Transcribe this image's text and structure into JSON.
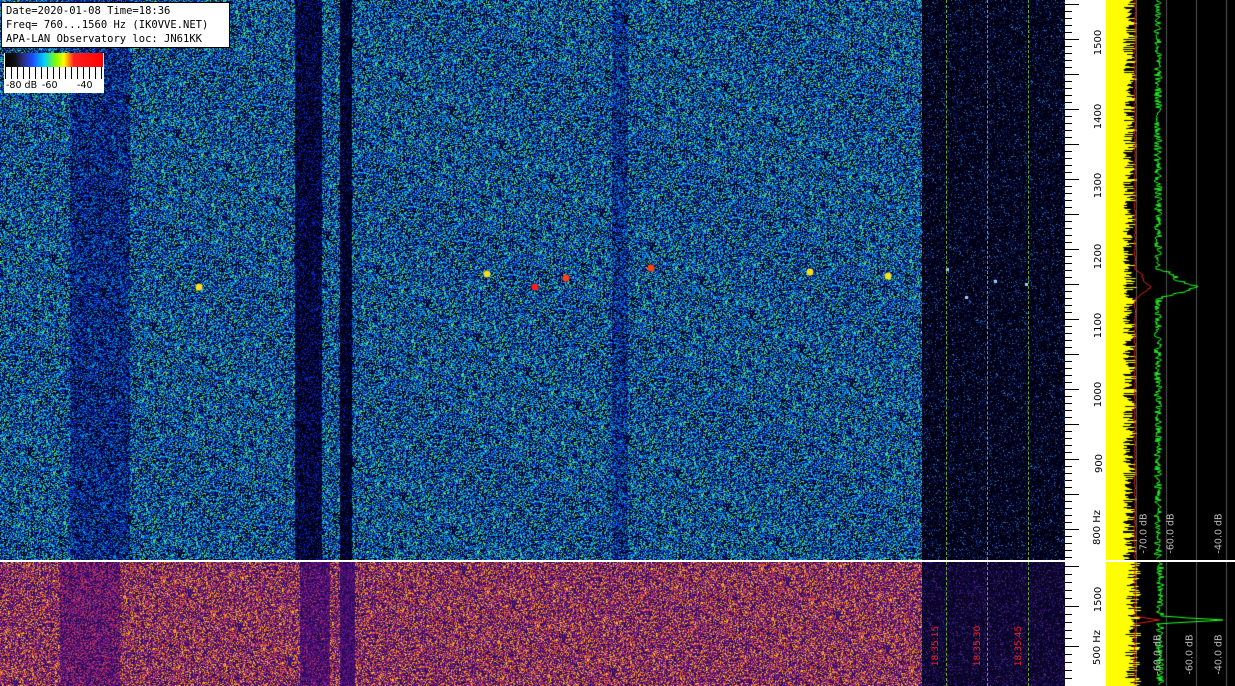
{
  "header": {
    "line1": "Date=2020-01-08 Time=18:36",
    "line2": "Freq= 760...1560 Hz (IK0VVE.NET)",
    "line3": "APA-LAN Observatory loc: JN61KK"
  },
  "colorbar": {
    "labels": [
      "-80 dB",
      "-60",
      "-40"
    ],
    "colors": [
      "#000000",
      "#1a4cff",
      "#00d0ff",
      "#7fff00",
      "#ffff00",
      "#ff0000"
    ]
  },
  "top_axis": {
    "ticks": [
      "1500",
      "1400",
      "1300",
      "1200",
      "1100",
      "1000",
      "900",
      "800 Hz"
    ]
  },
  "bottom_axis": {
    "ticks": [
      "1500",
      "500 Hz"
    ]
  },
  "top_spectrum": {
    "db_labels": [
      "-70.0 dB",
      "-60.0 dB",
      "-40.0 dB"
    ],
    "colors": {
      "average": "#ffff00",
      "peak": "#20ff20",
      "marker": "#e02020"
    }
  },
  "bottom_spectrum": {
    "db_labels": [
      "-60.0 dB",
      "-60.0 dB",
      "-40.0 dB"
    ]
  },
  "time_markers": [
    "18:35:15",
    "18:35:30",
    "18:35:45"
  ]
}
